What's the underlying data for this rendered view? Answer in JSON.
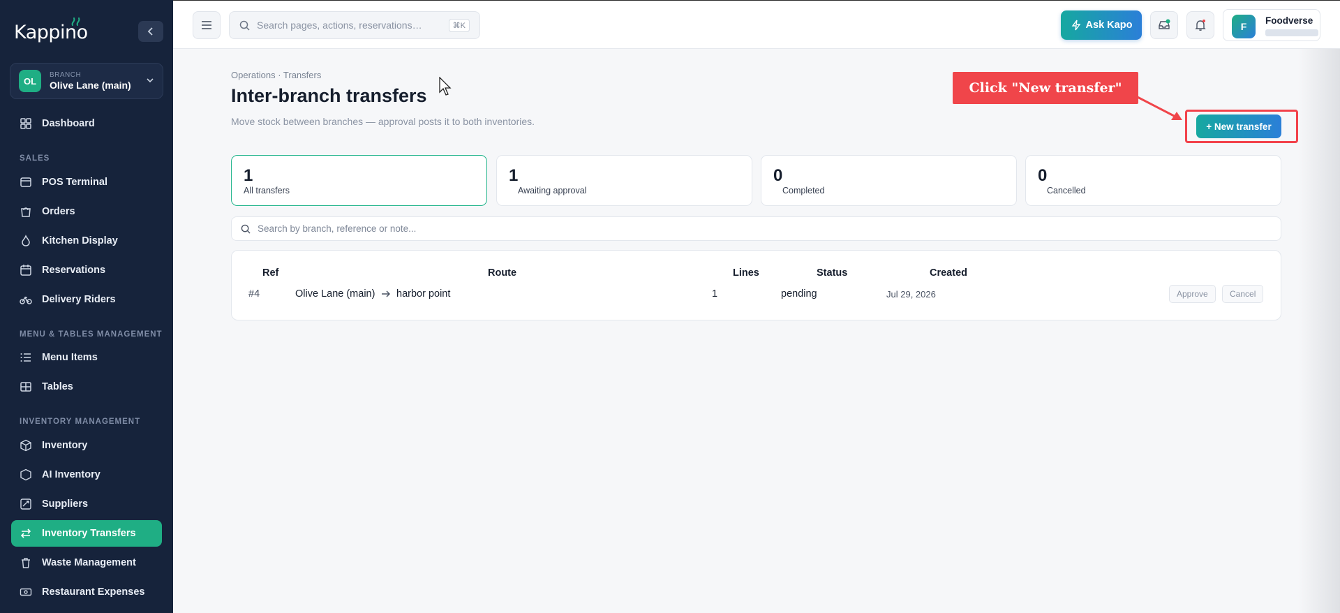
{
  "brand": {
    "name": "Kappino"
  },
  "branch": {
    "caption": "BRANCH",
    "initials": "OL",
    "name": "Olive Lane (main)"
  },
  "sidebar": {
    "items_top": [
      {
        "label": "Dashboard",
        "icon": "grid-icon"
      }
    ],
    "sections": [
      {
        "title": "SALES",
        "items": [
          {
            "label": "POS Terminal",
            "icon": "pos-icon"
          },
          {
            "label": "Orders",
            "icon": "bag-icon"
          },
          {
            "label": "Kitchen Display",
            "icon": "flame-icon"
          },
          {
            "label": "Reservations",
            "icon": "calendar-icon"
          },
          {
            "label": "Delivery Riders",
            "icon": "bike-icon"
          }
        ]
      },
      {
        "title": "MENU & TABLES MANAGEMENT",
        "items": [
          {
            "label": "Menu Items",
            "icon": "list-icon"
          },
          {
            "label": "Tables",
            "icon": "table-icon"
          }
        ]
      },
      {
        "title": "INVENTORY MANAGEMENT",
        "items": [
          {
            "label": "Inventory",
            "icon": "box-icon"
          },
          {
            "label": "AI Inventory",
            "icon": "ai-icon"
          },
          {
            "label": "Suppliers",
            "icon": "trend-icon"
          },
          {
            "label": "Inventory Transfers",
            "icon": "transfer-icon"
          },
          {
            "label": "Waste Management",
            "icon": "trash-icon"
          },
          {
            "label": "Restaurant Expenses",
            "icon": "cash-icon"
          }
        ]
      }
    ]
  },
  "topbar": {
    "search_placeholder": "Search pages, actions, reservations…",
    "shortcut": "⌘K",
    "ask_label": "Ask Kapo",
    "user_initial": "F",
    "user_name": "Foodverse"
  },
  "page": {
    "breadcrumb": "Operations · Transfers",
    "title": "Inter-branch transfers",
    "subtitle": "Move stock between branches — approval posts it to both inventories.",
    "new_button": "+ New transfer",
    "callout": "Click \"New transfer\""
  },
  "stats": [
    {
      "value": "1",
      "label": "All transfers"
    },
    {
      "value": "1",
      "label": "Awaiting approval"
    },
    {
      "value": "0",
      "label": "Completed"
    },
    {
      "value": "0",
      "label": "Cancelled"
    }
  ],
  "filter": {
    "placeholder": "Search by branch, reference or note..."
  },
  "table": {
    "headers": {
      "ref": "Ref",
      "route": "Route",
      "lines": "Lines",
      "status": "Status",
      "created": "Created"
    },
    "rows": [
      {
        "ref": "#4",
        "from": "Olive Lane (main)",
        "to": "harbor point",
        "lines": "1",
        "status": "pending",
        "created": "Jul 29, 2026",
        "approve": "Approve",
        "cancel": "Cancel"
      }
    ]
  },
  "colors": {
    "sidebar_bg": "#16233b",
    "accent_green": "#1fae84",
    "accent_blue": "#2b7fd8",
    "annotation_red": "#f0454a"
  }
}
